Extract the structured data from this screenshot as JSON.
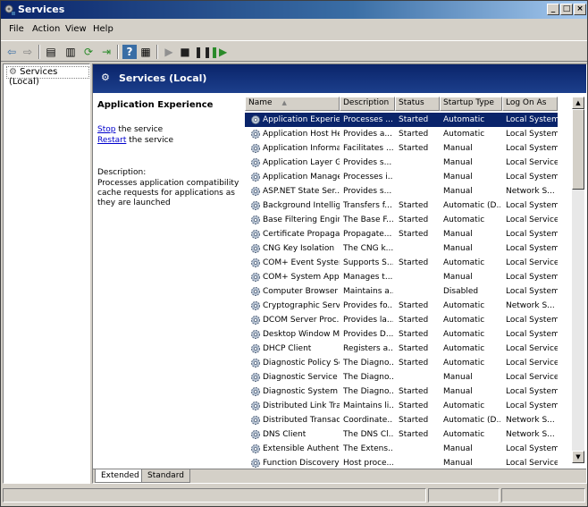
{
  "window": {
    "title": "Services"
  },
  "menu": [
    "File",
    "Action",
    "View",
    "Help"
  ],
  "tree": {
    "root": "Services (Local)"
  },
  "header": {
    "title": "Services (Local)"
  },
  "details": {
    "service_name": "Application Experience",
    "stop_link": "Stop",
    "stop_suffix": " the service",
    "restart_link": "Restart",
    "restart_suffix": " the service",
    "desc_label": "Description:",
    "description": "Processes application compatibility cache requests for applications as they are launched"
  },
  "columns": [
    "Name",
    "Description",
    "Status",
    "Startup Type",
    "Log On As"
  ],
  "services": [
    [
      "Application Experie...",
      "Processes ...",
      "Started",
      "Automatic",
      "Local System"
    ],
    [
      "Application Host He...",
      "Provides a...",
      "Started",
      "Automatic",
      "Local System"
    ],
    [
      "Application Informa...",
      "Facilitates ...",
      "Started",
      "Manual",
      "Local System"
    ],
    [
      "Application Layer G...",
      "Provides s...",
      "",
      "Manual",
      "Local Service"
    ],
    [
      "Application Manage...",
      "Processes i...",
      "",
      "Manual",
      "Local System"
    ],
    [
      "ASP.NET State Ser...",
      "Provides s...",
      "",
      "Manual",
      "Network S..."
    ],
    [
      "Background Intellig...",
      "Transfers f...",
      "Started",
      "Automatic (D...",
      "Local System"
    ],
    [
      "Base Filtering Engine",
      "The Base F...",
      "Started",
      "Automatic",
      "Local Service"
    ],
    [
      "Certificate Propaga...",
      "Propagate...",
      "Started",
      "Manual",
      "Local System"
    ],
    [
      "CNG Key Isolation",
      "The CNG k...",
      "",
      "Manual",
      "Local System"
    ],
    [
      "COM+ Event System",
      "Supports S...",
      "Started",
      "Automatic",
      "Local Service"
    ],
    [
      "COM+ System Appl...",
      "Manages t...",
      "",
      "Manual",
      "Local System"
    ],
    [
      "Computer Browser",
      "Maintains a...",
      "",
      "Disabled",
      "Local System"
    ],
    [
      "Cryptographic Serv...",
      "Provides fo...",
      "Started",
      "Automatic",
      "Network S..."
    ],
    [
      "DCOM Server Proc...",
      "Provides la...",
      "Started",
      "Automatic",
      "Local System"
    ],
    [
      "Desktop Window M...",
      "Provides D...",
      "Started",
      "Automatic",
      "Local System"
    ],
    [
      "DHCP Client",
      "Registers a...",
      "Started",
      "Automatic",
      "Local Service"
    ],
    [
      "Diagnostic Policy Se...",
      "The Diagno...",
      "Started",
      "Automatic",
      "Local Service"
    ],
    [
      "Diagnostic Service ...",
      "The Diagno...",
      "",
      "Manual",
      "Local Service"
    ],
    [
      "Diagnostic System ...",
      "The Diagno...",
      "Started",
      "Manual",
      "Local System"
    ],
    [
      "Distributed Link Tra...",
      "Maintains li...",
      "Started",
      "Automatic",
      "Local System"
    ],
    [
      "Distributed Transac...",
      "Coordinate...",
      "Started",
      "Automatic (D...",
      "Network S..."
    ],
    [
      "DNS Client",
      "The DNS Cl...",
      "Started",
      "Automatic",
      "Network S..."
    ],
    [
      "Extensible Authenti...",
      "The Extens...",
      "",
      "Manual",
      "Local System"
    ],
    [
      "Function Discovery ...",
      "Host proce...",
      "",
      "Manual",
      "Local Service"
    ]
  ],
  "tabs": [
    "Extended",
    "Standard"
  ],
  "colors": {
    "banner": "#0a246a",
    "selection": "#0a246a",
    "link": "#0000cc"
  }
}
